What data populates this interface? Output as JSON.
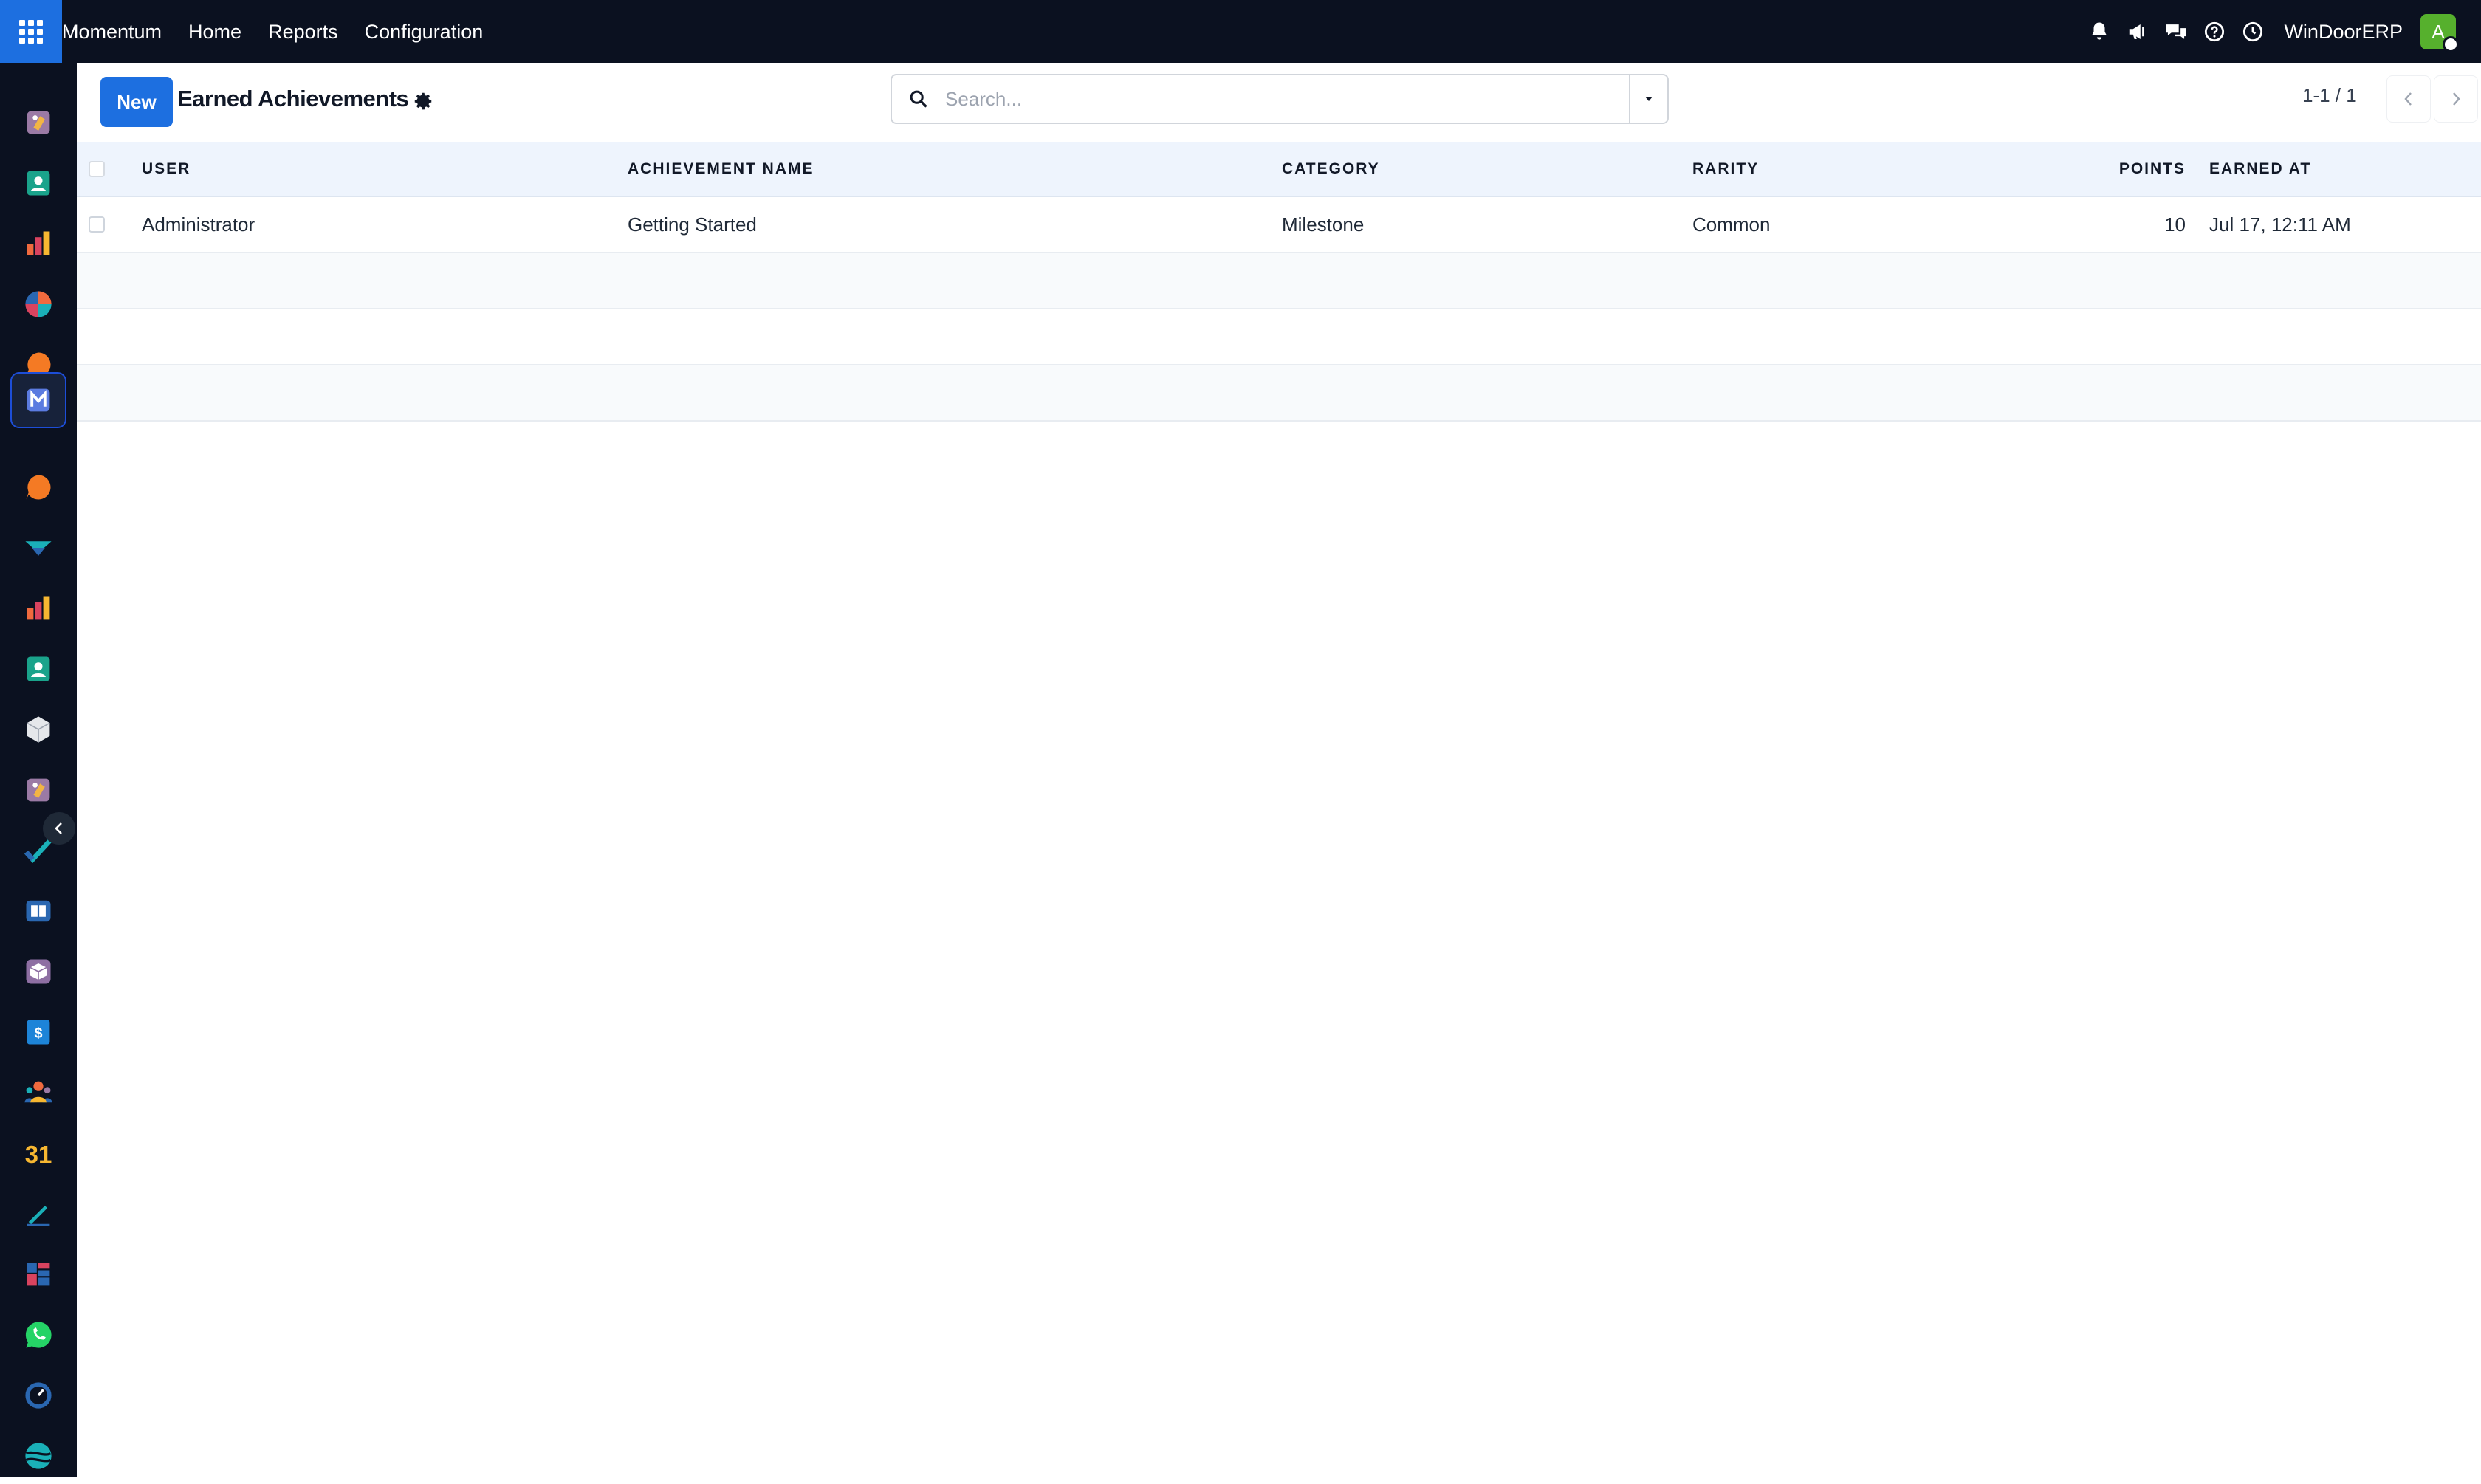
{
  "navbar": {
    "brand": "Momentum",
    "menu": [
      "Home",
      "Reports",
      "Configuration"
    ],
    "company": "WinDoorERP",
    "avatar_letter": "A",
    "icons": [
      "bell-icon",
      "megaphone-icon",
      "chat-icon",
      "help-icon",
      "clock-icon"
    ]
  },
  "sidebar": {
    "icons": [
      "app-icon-1",
      "contacts-icon",
      "reports-icon",
      "dashboard-pie-icon",
      "discuss-icon",
      "momentum-icon",
      "discuss-icon-2",
      "inventory-icon",
      "reports-icon-2",
      "contacts-icon-2",
      "product-box-icon",
      "app-icon-2",
      "project-check-icon",
      "knowledge-icon",
      "package-icon",
      "invoicing-icon",
      "employees-icon",
      "calendar-icon",
      "sign-icon",
      "spreadsheet-icon",
      "whatsapp-icon",
      "timer-icon",
      "website-icon"
    ],
    "active_index": 5,
    "calendar_glyph": "31"
  },
  "control": {
    "new_label": "New",
    "title": "Earned Achievements",
    "search_placeholder": "Search...",
    "pager": "1-1 / 1"
  },
  "table": {
    "columns": [
      "USER",
      "ACHIEVEMENT NAME",
      "CATEGORY",
      "RARITY",
      "POINTS",
      "EARNED AT"
    ],
    "rows": [
      {
        "user": "Administrator",
        "achievement": "Getting Started",
        "category": "Milestone",
        "rarity": "Common",
        "points": "10",
        "earned_at": "Jul 17, 12:11 AM"
      }
    ]
  },
  "colors": {
    "navbar_bg": "#0b1120",
    "accent": "#1d6fe0",
    "header_row": "#eef4fd",
    "avatar": "#56b02d"
  }
}
